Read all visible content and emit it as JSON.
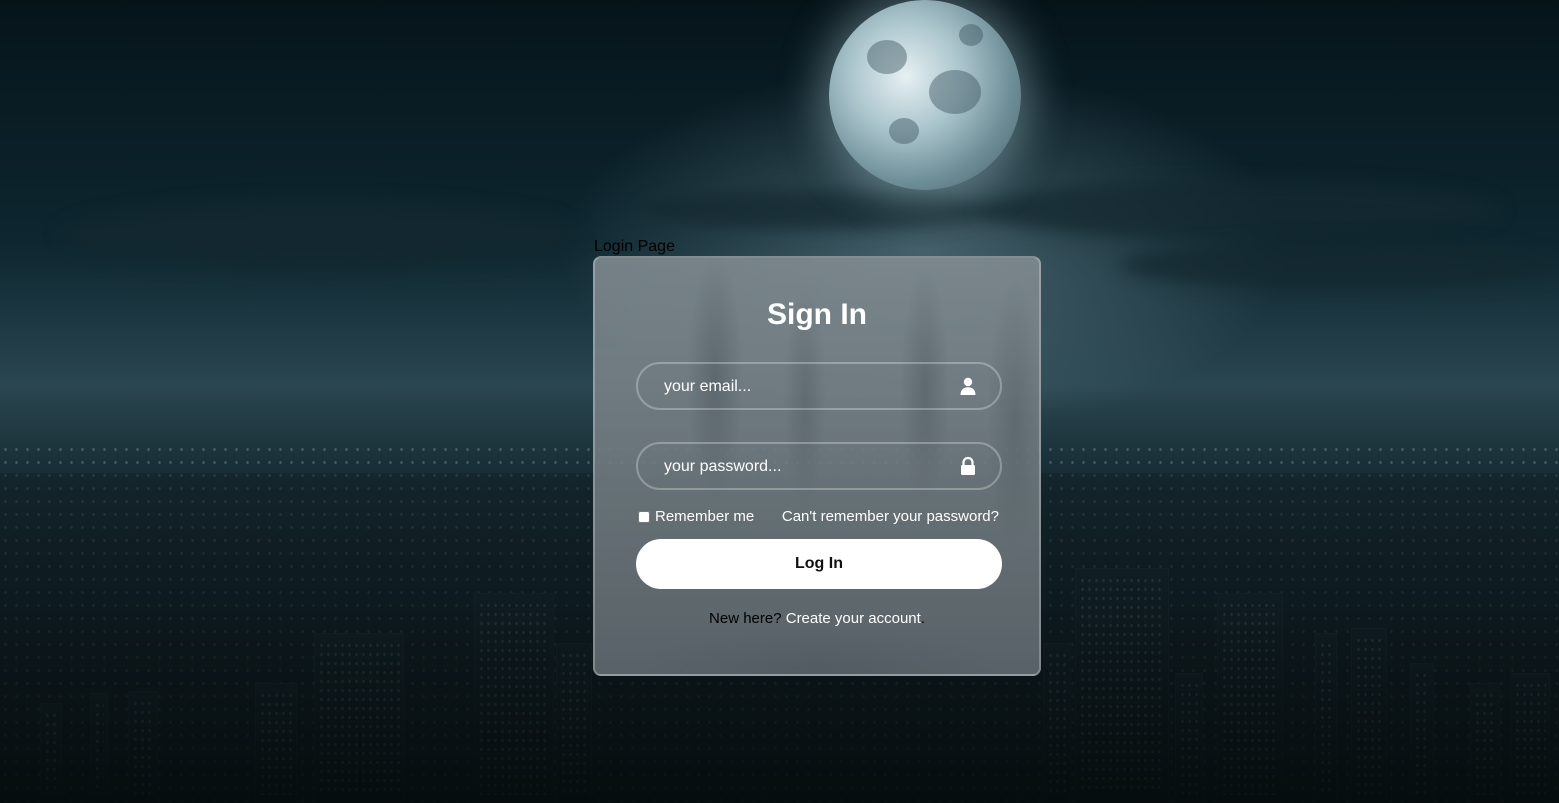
{
  "page": {
    "title": "Login Page"
  },
  "form": {
    "heading": "Sign In",
    "email": {
      "placeholder": "your email...",
      "value": "",
      "icon": "user-icon"
    },
    "password": {
      "placeholder": "your password...",
      "value": "",
      "icon": "lock-icon"
    },
    "remember_label": "Remember me",
    "remember_checked": false,
    "forgot_label": "Can't remember your password?",
    "submit_label": "Log In",
    "register_prompt": "New here?",
    "register_link": "Create your account",
    "register_suffix": "."
  },
  "colors": {
    "card_bg": "#7e898d",
    "button_bg": "#ffffff",
    "text_light": "#ffffff"
  }
}
